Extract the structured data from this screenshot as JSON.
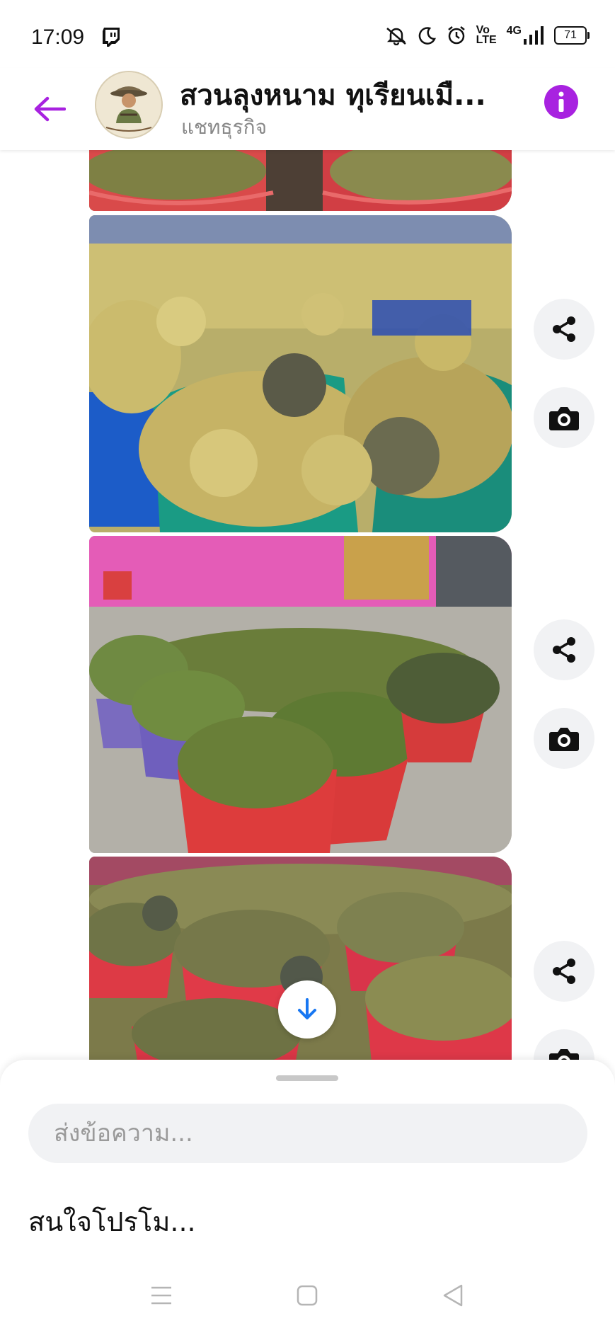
{
  "status_bar": {
    "time": "17:09",
    "network": "4G",
    "battery": "71",
    "icons": [
      "twitch-icon",
      "mute-icon",
      "moon-icon",
      "alarm-icon",
      "volte-icon",
      "signal-icon",
      "battery-icon"
    ]
  },
  "header": {
    "title": "สวนลุงหนาม ทุเรียนเมื...",
    "subtitle": "แชทธุรกิจ",
    "accent_color": "#a822e0"
  },
  "messages": [
    {
      "type": "photo",
      "subject": "durians-in-red-baskets"
    },
    {
      "type": "photo",
      "subject": "durians-in-blue-green-baskets"
    },
    {
      "type": "photo",
      "subject": "durians-in-red-baskets-warehouse"
    },
    {
      "type": "photo",
      "subject": "durians-in-red-baskets-rows"
    }
  ],
  "composer": {
    "placeholder": "ส่งข้อความ...",
    "quick_reply": "สนใจโปรโม..."
  }
}
